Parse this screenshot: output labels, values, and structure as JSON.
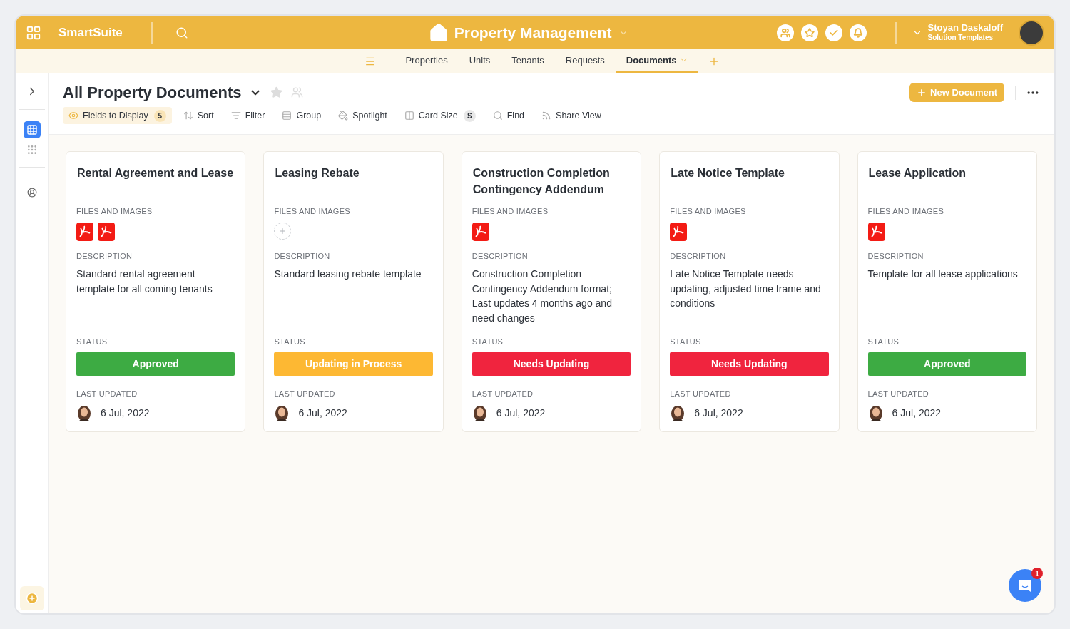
{
  "app": {
    "name": "SmartSuite"
  },
  "workspace": {
    "title": "Property Management"
  },
  "user": {
    "name": "Stoyan Daskaloff",
    "subtitle": "Solution Templates"
  },
  "tabs": [
    {
      "label": "Properties",
      "selected": false
    },
    {
      "label": "Units",
      "selected": false
    },
    {
      "label": "Tenants",
      "selected": false
    },
    {
      "label": "Requests",
      "selected": false
    },
    {
      "label": "Documents",
      "selected": true
    }
  ],
  "view": {
    "title": "All Property Documents",
    "new_button": "New Document"
  },
  "toolbar": [
    {
      "label": "Fields to Display",
      "badge": "5",
      "highlighted": true
    },
    {
      "label": "Sort",
      "highlighted": false
    },
    {
      "label": "Filter",
      "highlighted": false
    },
    {
      "label": "Group",
      "highlighted": false
    },
    {
      "label": "Spotlight",
      "highlighted": false
    },
    {
      "label": "Card Size",
      "badge": "S",
      "highlighted": false
    },
    {
      "label": "Find",
      "highlighted": false
    },
    {
      "label": "Share View",
      "highlighted": false
    }
  ],
  "cards": [
    {
      "title": "Rental Agreement and Lease",
      "files_label": "FILES AND IMAGES",
      "files": [
        {
          "kind": "pdf"
        },
        {
          "kind": "pdf"
        }
      ],
      "description_label": "DESCRIPTION",
      "description": "Standard rental agreement template for all coming tenants",
      "status_label": "STATUS",
      "status": {
        "label": "Approved",
        "kind": "approved"
      },
      "updated_label": "LAST UPDATED",
      "date": "6 Jul, 2022"
    },
    {
      "title": "Leasing Rebate",
      "files_label": "FILES AND IMAGES",
      "description_label": "DESCRIPTION",
      "description": "Standard leasing rebate template",
      "status_label": "STATUS",
      "status": {
        "label": "Updating in Process",
        "kind": "in_progress"
      },
      "updated_label": "LAST UPDATED",
      "date": "6 Jul, 2022"
    },
    {
      "title": "Construction Completion Contingency Addendum",
      "files_label": "FILES AND IMAGES",
      "files": [
        {
          "kind": "pdf"
        }
      ],
      "description_label": "DESCRIPTION",
      "description": "Construction Completion Contingency Addendum format; Last updates 4 months ago and need changes",
      "status_label": "STATUS",
      "status": {
        "label": "Needs Updating",
        "kind": "needs_update"
      },
      "updated_label": "LAST UPDATED",
      "date": "6 Jul, 2022"
    },
    {
      "title": "Late Notice Template",
      "files_label": "FILES AND IMAGES",
      "files": [
        {
          "kind": "pdf"
        }
      ],
      "description_label": "DESCRIPTION",
      "description": "Late Notice Template needs updating, adjusted time frame and conditions",
      "status_label": "STATUS",
      "status": {
        "label": "Needs Updating",
        "kind": "needs_update"
      },
      "updated_label": "LAST UPDATED",
      "date": "6 Jul, 2022"
    },
    {
      "title": "Lease Application",
      "files_label": "FILES AND IMAGES",
      "files": [
        {
          "kind": "pdf"
        }
      ],
      "description_label": "DESCRIPTION",
      "description": "Template for all lease applications",
      "status_label": "STATUS",
      "status": {
        "label": "Approved",
        "kind": "approved"
      },
      "updated_label": "LAST UPDATED",
      "date": "6 Jul, 2022"
    }
  ],
  "chat": {
    "badge": "1"
  }
}
